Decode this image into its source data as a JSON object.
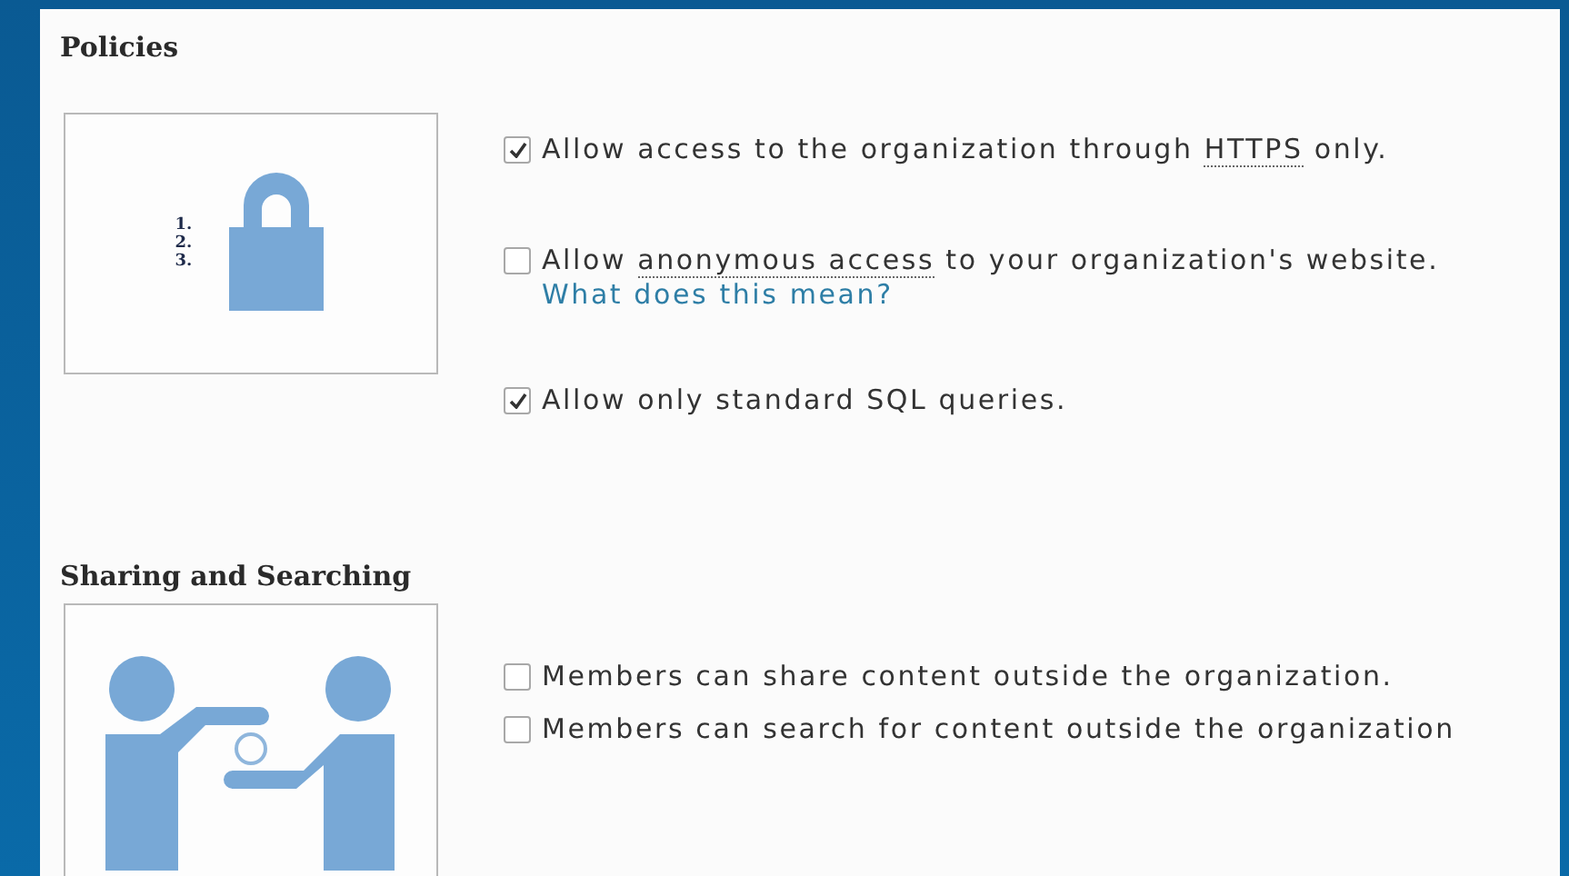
{
  "sections": [
    {
      "title": "Policies",
      "illustration": {
        "kind": "lock",
        "numbers": [
          "1.",
          "2.",
          "3."
        ]
      },
      "options": [
        {
          "label": [
            {
              "text": "Allow access to the organization through "
            },
            {
              "text": "HTTPS",
              "abbr": true
            },
            {
              "text": " only."
            }
          ],
          "checked": true
        },
        {
          "label": [
            {
              "text": "Allow "
            },
            {
              "text": "anonymous access",
              "abbr": true
            },
            {
              "text": " to your organization's website."
            }
          ],
          "checked": false,
          "link": "What does this mean?"
        },
        {
          "label": [
            {
              "text": "Allow only standard SQL queries."
            }
          ],
          "checked": true
        }
      ]
    },
    {
      "title": "Sharing and Searching",
      "illustration": {
        "kind": "sharing"
      },
      "options": [
        {
          "label": [
            {
              "text": "Members can share content outside the organization."
            }
          ],
          "checked": false
        },
        {
          "label": [
            {
              "text": "Members can search for content outside the organization"
            }
          ],
          "checked": false
        }
      ]
    }
  ]
}
